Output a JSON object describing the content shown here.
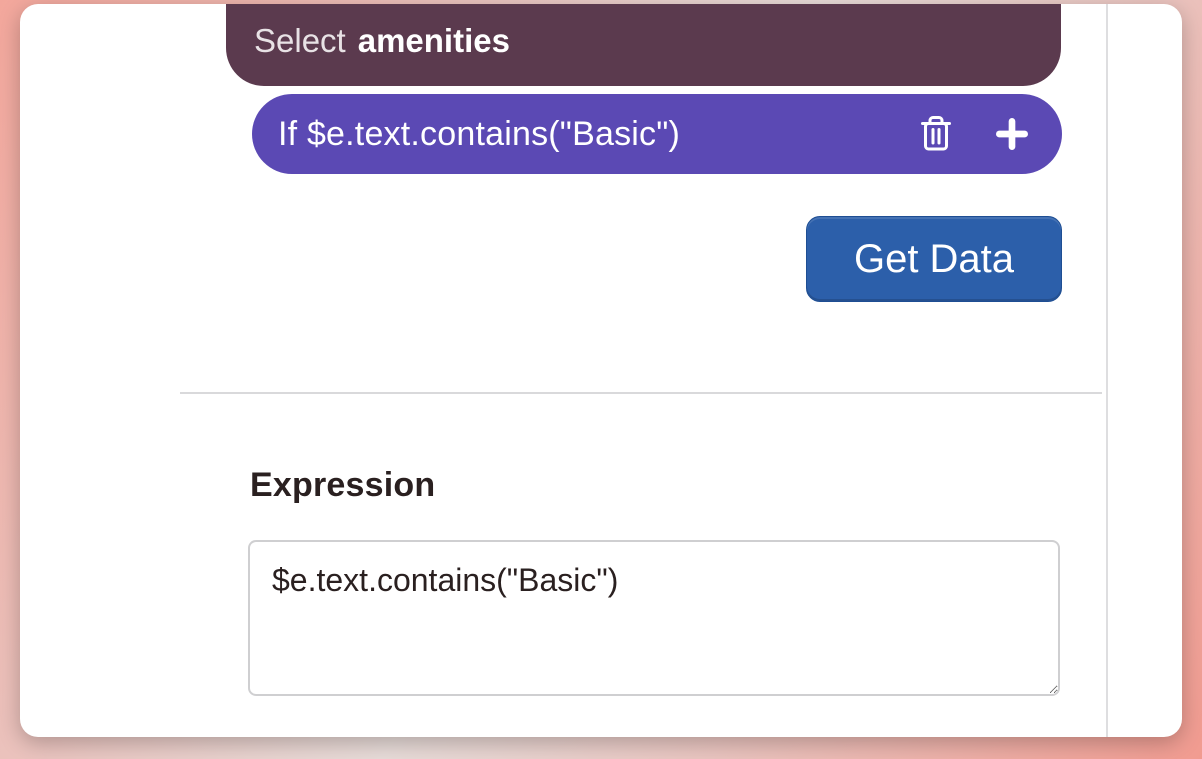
{
  "select_block": {
    "prefix": "Select",
    "target": "amenities"
  },
  "condition_block": {
    "text": "If $e.text.contains(\"Basic\")"
  },
  "buttons": {
    "get_data": "Get Data"
  },
  "expression": {
    "heading": "Expression",
    "value": "$e.text.contains(\"Basic\")"
  },
  "icons": {
    "trash": "trash-icon",
    "plus": "plus-icon"
  }
}
